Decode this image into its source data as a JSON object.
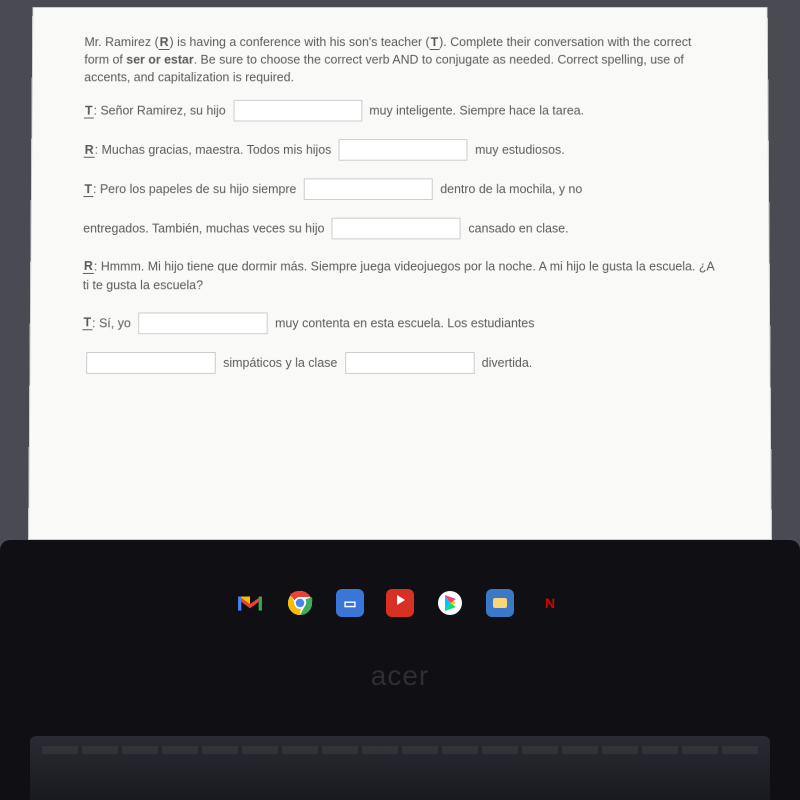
{
  "instructions": {
    "pre_r": "Mr. Ramirez (",
    "r": "R",
    "mid": ") is having a conference with his son's teacher (",
    "t": "T",
    "post_t": "). Complete their conversation with the correct form of ",
    "bold": "ser or estar",
    "tail": ". Be sure to choose the correct verb AND to conjugate as needed. Correct spelling, use of accents, and capitalization is required."
  },
  "dialog": {
    "l1": {
      "speaker": "T",
      "a": ": Señor Ramirez, su hijo ",
      "b": " muy inteligente.  Siempre hace la tarea."
    },
    "l2": {
      "speaker": "R",
      "a": ": Muchas gracias, maestra.  Todos mis hijos ",
      "b": " muy estudiosos."
    },
    "l3": {
      "speaker": "T",
      "a": ": Pero los papeles de su hijo siempre ",
      "b": " dentro de la mochila, y no"
    },
    "l4": {
      "a": "entregados.  También, muchas veces su hijo ",
      "b": " cansado en clase."
    },
    "l5": {
      "speaker": "R",
      "a": ": Hmmm.  Mi hijo tiene que dormir más.  Siempre juega videojuegos por la noche.  A mi hijo le gusta la escuela.  ¿A ti te gusta la escuela?"
    },
    "l6": {
      "speaker": "T",
      "a": ": Sí, yo ",
      "b": " muy contenta en esta escuela.  Los estudiantes"
    },
    "l7": {
      "a": "",
      "b": " simpáticos y la clase ",
      "c": " divertida."
    }
  },
  "brand": "acer"
}
